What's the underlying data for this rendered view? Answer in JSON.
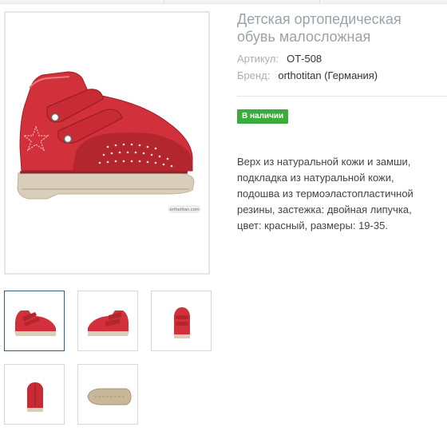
{
  "product": {
    "title": "Детская ортопедическая обувь малосложная",
    "article_label": "Артикул:",
    "article_value": "ОТ-508",
    "brand_label": "Бренд:",
    "brand_value": "orthotitan (Германия)",
    "availability": "В наличии",
    "description": "Верх из натуральной кожи и замши, подкладка из натуральной кожи, подошва из термоэластопластичной резины, застежка: двойная липучка, цвет: красный, размеры: 19-35."
  },
  "images": {
    "main_alt": "orthotitan shoe",
    "watermark": "orthotitan.com",
    "thumbnails": [
      {
        "view": "side-left",
        "active": true
      },
      {
        "view": "side-right",
        "active": false
      },
      {
        "view": "front",
        "active": false
      },
      {
        "view": "back",
        "active": false
      },
      {
        "view": "sole",
        "active": false
      }
    ]
  },
  "colors": {
    "leather_red": "#d2303a",
    "suede_red": "#b3262e",
    "sole": "#d9ceb9",
    "badge_green": "#3cab3b",
    "title_gray": "#9aa3ab",
    "active_thumb_border": "#2d5f86"
  }
}
